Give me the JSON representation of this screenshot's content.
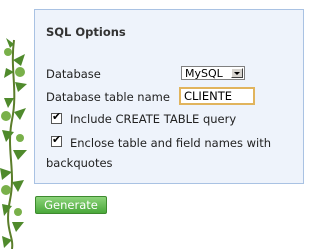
{
  "panel": {
    "title": "SQL Options",
    "database_label": "Database",
    "database_value": "MySQL",
    "table_name_label": "Database table name",
    "table_name_value": "CLIENTE",
    "include_create_label": "Include CREATE TABLE query",
    "include_create_checked": true,
    "enclose_label_line1": "Enclose table and field names with",
    "enclose_label_line2": "backquotes",
    "enclose_checked": true
  },
  "actions": {
    "generate_label": "Generate"
  },
  "colors": {
    "panel_bg": "#eef3fb",
    "panel_border": "#a9c2e3",
    "button_green": "#4aa83a",
    "input_focus_border": "#e1b45d"
  },
  "icons": [
    "ivy-vine-decoration",
    "chevron-down-icon",
    "checkmark-icon"
  ]
}
